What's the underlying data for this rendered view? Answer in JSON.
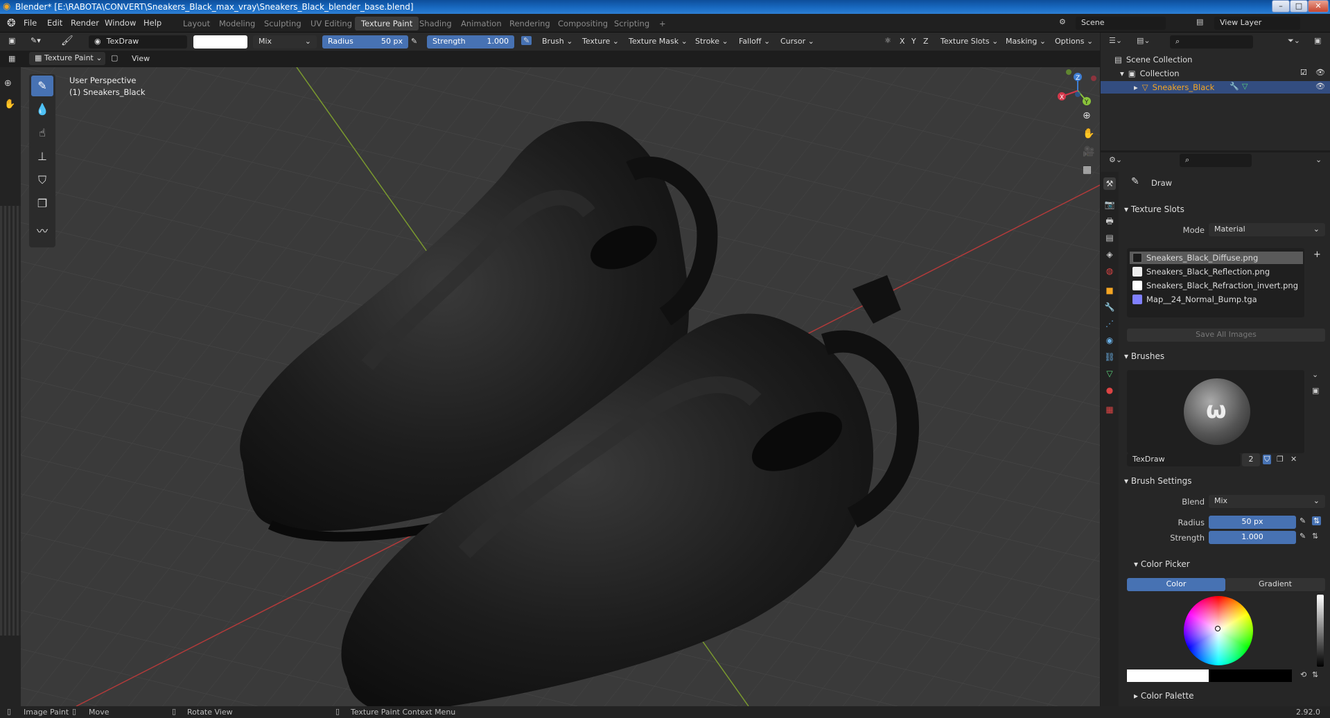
{
  "window": {
    "title": "Blender* [E:\\RABOTA\\CONVERT\\Sneakers_Black_max_vray\\Sneakers_Black_blender_base.blend]",
    "min": "–",
    "max": "□",
    "close": "✕"
  },
  "menu": [
    "File",
    "Edit",
    "Render",
    "Window",
    "Help"
  ],
  "workspaces": [
    "Layout",
    "Modeling",
    "Sculpting",
    "UV Editing",
    "Texture Paint",
    "Shading",
    "Animation",
    "Rendering",
    "Compositing",
    "Scripting",
    "+"
  ],
  "scene": {
    "label": "Scene",
    "view_layer": "View Layer"
  },
  "toolhdr": {
    "brush_name": "TexDraw",
    "blend": "Mix",
    "radius_label": "Radius",
    "radius_value": "50 px",
    "strength_label": "Strength",
    "strength_value": "1.000",
    "menus": [
      "Brush",
      "Texture",
      "Texture Mask",
      "Stroke",
      "Falloff",
      "Cursor"
    ],
    "axes": [
      "X",
      "Y",
      "Z"
    ],
    "right_menus": [
      "Texture Slots",
      "Masking",
      "Options"
    ]
  },
  "hdr2": {
    "mode": "Texture Paint",
    "view": "View"
  },
  "viewport": {
    "perspective": "User Perspective",
    "object": "(1) Sneakers_Black"
  },
  "gizmo": {
    "x": "X",
    "y": "Y",
    "z": "Z"
  },
  "outliner": {
    "scene_collection": "Scene Collection",
    "collection": "Collection",
    "object": "Sneakers_Black"
  },
  "props": {
    "tool": "Draw",
    "texture_slots": "Texture Slots",
    "mode_label": "Mode",
    "mode_value": "Material",
    "slots": [
      {
        "name": "Sneakers_Black_Diffuse.png",
        "color": "#1a1a1a"
      },
      {
        "name": "Sneakers_Black_Reflection.png",
        "color": "#eeeeee"
      },
      {
        "name": "Sneakers_Black_Refraction_invert.png",
        "color": "#ffffff"
      },
      {
        "name": "Map__24_Normal_Bump.tga",
        "color": "#8080ff"
      }
    ],
    "save_all": "Save All Images",
    "brushes": "Brushes",
    "brush_name": "TexDraw",
    "brush_users": "2",
    "brush_settings": "Brush Settings",
    "blend_label": "Blend",
    "blend_value": "Mix",
    "radius_label": "Radius",
    "radius_value": "50 px",
    "strength_label": "Strength",
    "strength_value": "1.000",
    "color_picker": "Color Picker",
    "color_tab": "Color",
    "gradient_tab": "Gradient",
    "color_palette": "Color Palette"
  },
  "status": {
    "image_paint": "Image Paint",
    "move": "Move",
    "rotate": "Rotate View",
    "context": "Texture Paint Context Menu",
    "version": "2.92.0"
  }
}
